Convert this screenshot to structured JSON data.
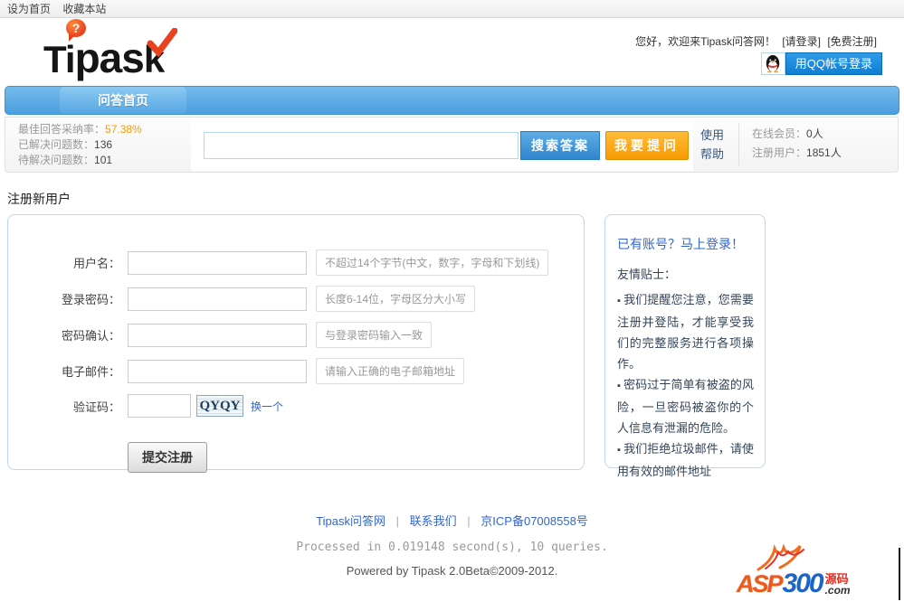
{
  "colors": {
    "nav_blue": "#4c9edf",
    "button_search_blue": "#2f86cd",
    "button_ask_orange": "#f79a02",
    "qq_blue": "#0f7ed2",
    "link_blue": "#3366cc",
    "stat_highlight_orange": "#ff9900",
    "panel_border_blue": "#bcd9ef"
  },
  "topbar": {
    "set_home": "设为首页",
    "add_favorite": "收藏本站"
  },
  "header": {
    "logo": {
      "part1": "Ti",
      "part2": "pas",
      "part3": "k",
      "bubble": "?"
    },
    "welcome": "您好，欢迎来Tipask问答网！",
    "login_link": "[请登录]",
    "register_link": "[免费注册]",
    "qq_login_label": "用QQ帐号登录"
  },
  "nav": {
    "home_tab": "问答首页"
  },
  "statsbar": {
    "stats": [
      {
        "label": "最佳回答采纳率：",
        "value": "57.38%"
      },
      {
        "label": "已解决问题数：",
        "value": "136"
      },
      {
        "label": "待解决问题数：",
        "value": "101"
      }
    ],
    "search_button": "搜索答案",
    "ask_button": "我要提问",
    "help_line1": "使用",
    "help_line2": "帮助",
    "members": [
      {
        "label": "在线会员：",
        "value": "0人"
      },
      {
        "label": "注册用户：",
        "value": "1851人"
      }
    ]
  },
  "form": {
    "title": "注册新用户",
    "fields": [
      {
        "label": "用户名：",
        "hint": "不超过14个字节(中文，数字，字母和下划线)"
      },
      {
        "label": "登录密码：",
        "hint": "长度6-14位，字母区分大小写"
      },
      {
        "label": "密码确认：",
        "hint": "与登录密码输入一致"
      },
      {
        "label": "电子邮件：",
        "hint": "请输入正确的电子邮箱地址"
      }
    ],
    "captcha": {
      "label": "验证码：",
      "image_text": "QYQY",
      "refresh_link": "换一个"
    },
    "submit_button": "提交注册"
  },
  "sidebar": {
    "login_link": "已有账号？马上登录！",
    "tips_title": "友情贴士：",
    "tips": [
      "我们提醒您注意，您需要注册并登陆，才能享受我们的完整服务进行各项操作。",
      "密码过于简单有被盗的风险，一旦密码被盗你的个人信息有泄漏的危险。",
      "我们拒绝垃圾邮件，请使用有效的邮件地址"
    ]
  },
  "footer": {
    "links": [
      "Tipask问答网",
      "联系我们",
      "京ICP备07008558号"
    ],
    "separator": "|",
    "processed": "Processed in 0.019148 second(s), 10 queries.",
    "powered": "Powered by Tipask 2.0Beta©2009-2012."
  },
  "watermark": {
    "asp": "ASP",
    "num": "300",
    "yuanma": "源码",
    "com": ".com"
  }
}
